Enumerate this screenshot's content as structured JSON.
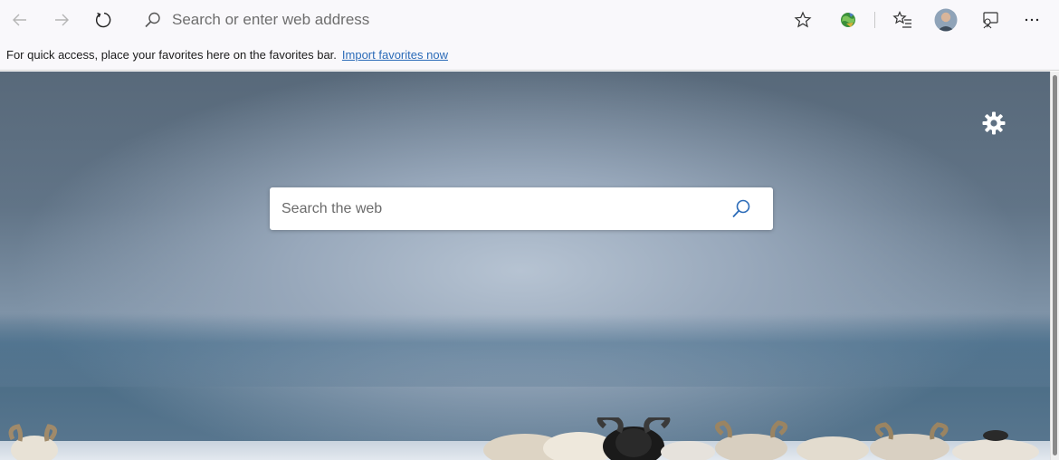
{
  "toolbar": {
    "back_icon": "back-arrow-icon",
    "forward_icon": "forward-arrow-icon",
    "refresh_icon": "refresh-icon",
    "address_placeholder": "Search or enter web address",
    "address_value": "",
    "search_icon": "search-icon",
    "favorite_star_icon": "star-icon",
    "extension_icon": "globe-extension-icon",
    "favorites_list_icon": "favorites-list-icon",
    "profile_icon": "avatar",
    "feedback_icon": "feedback-icon",
    "more_icon": "more-dots-icon"
  },
  "favbar": {
    "message": "For quick access, place your favorites here on the favorites bar.",
    "import_link": "Import favorites now"
  },
  "newtab": {
    "search_placeholder": "Search the web",
    "search_value": "",
    "settings_icon": "gear-icon",
    "search_submit_icon": "search-icon"
  },
  "colors": {
    "accent": "#2b6bb8",
    "toolbar_bg": "#f9f8fb",
    "search_icon_blue": "#2b6bb8"
  }
}
